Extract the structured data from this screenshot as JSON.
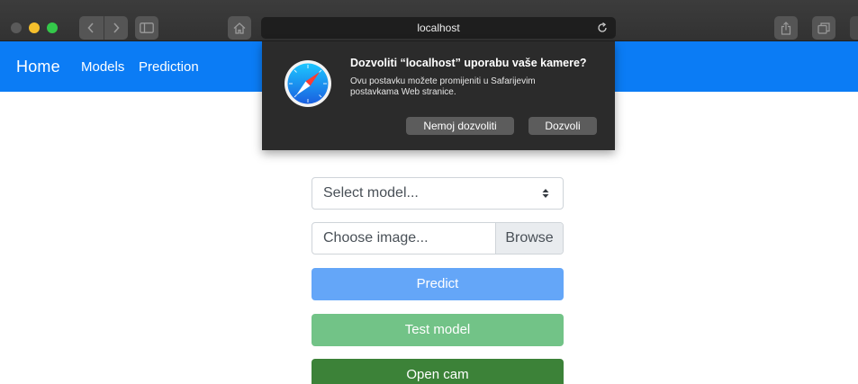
{
  "browser": {
    "url": "localhost"
  },
  "navbar": {
    "brand": "Home",
    "links": [
      "Models",
      "Prediction"
    ]
  },
  "permission_dialog": {
    "title": "Dozvoliti “localhost” uporabu vaše kamere?",
    "message": "Ovu postavku možete promijeniti u Safarijevim postavkama Web stranice.",
    "deny_label": "Nemoj dozvoliti",
    "allow_label": "Dozvoli"
  },
  "form": {
    "model_select": {
      "placeholder": "Select model..."
    },
    "file_input": {
      "placeholder": "Choose image...",
      "browse_label": "Browse"
    },
    "buttons": {
      "predict": "Predict",
      "test": "Test model",
      "cam": "Open cam"
    }
  },
  "colors": {
    "navbar": "#0b7cf5",
    "predict_button": "#64a6f8",
    "test_button": "#72c387",
    "cam_button": "#3c8238",
    "dialog_background": "#2b2b2b"
  },
  "icons": {
    "browser_app": "safari-compass-icon"
  }
}
